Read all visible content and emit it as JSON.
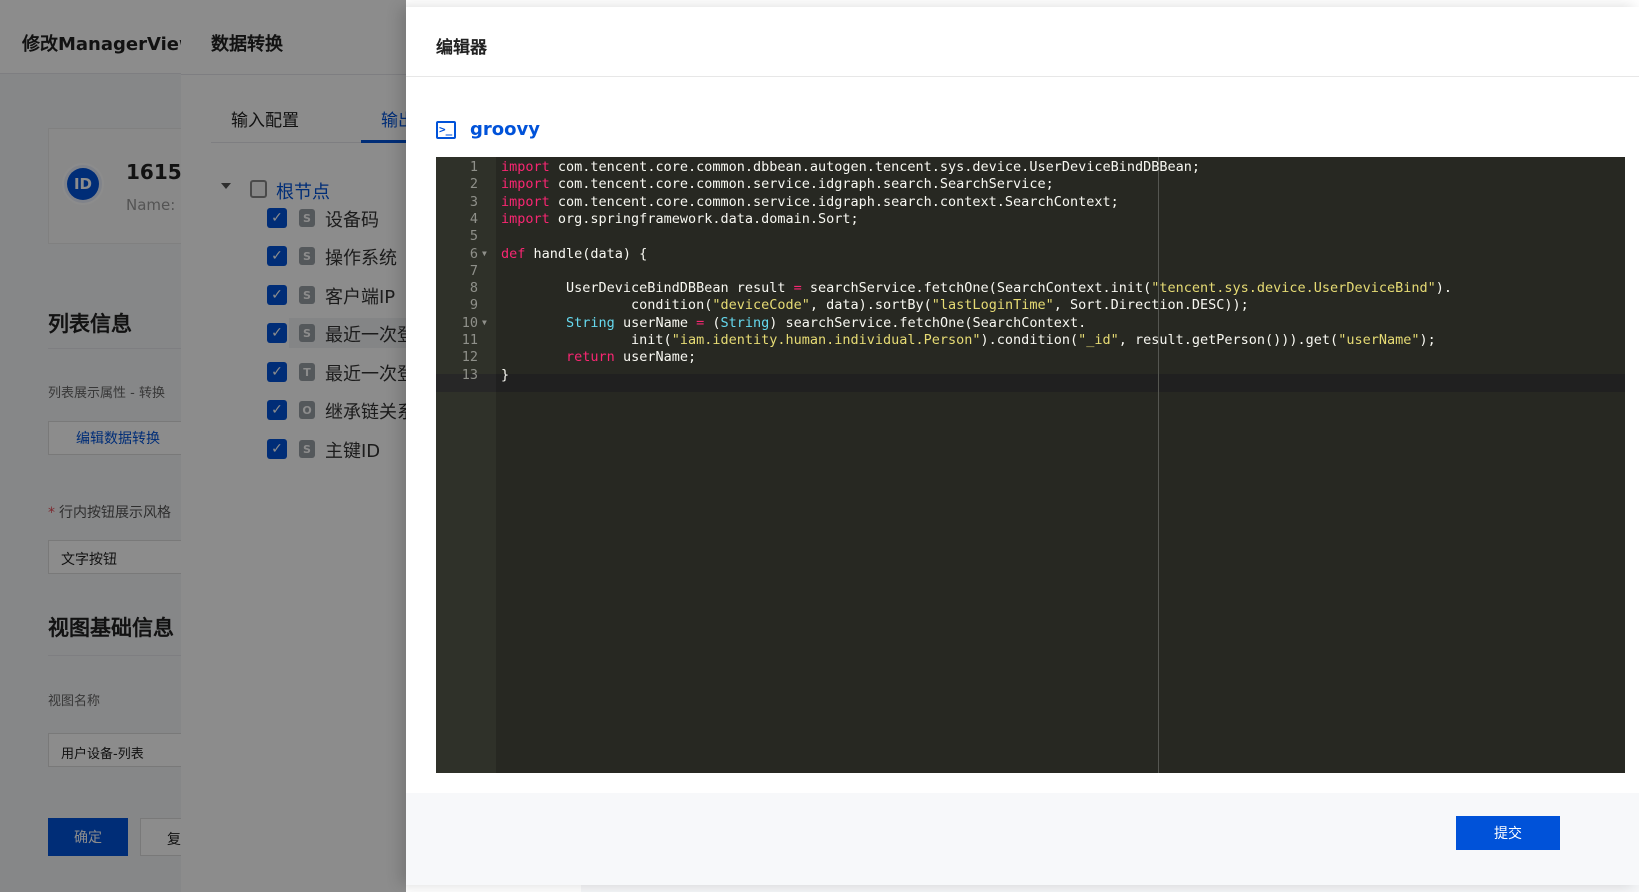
{
  "base_page": {
    "title": "修改ManagerView",
    "id_badge": "ID",
    "id_number": "1615",
    "id_name_prefix": "Name:",
    "section_list_info": "列表信息",
    "list_subtitle": "列表展示属性 - 转换",
    "edit_transform_button": "编辑数据转换",
    "inline_button_style_label": "行内按钮展示风格",
    "inline_button_style_value": "文字按钮",
    "section_view_basic": "视图基础信息",
    "view_name_label": "视图名称",
    "view_name_value": "用户设备-列表",
    "confirm_button": "确定",
    "reset_button": "复"
  },
  "transform_drawer": {
    "title": "数据转换",
    "tabs": [
      {
        "label": "输入配置"
      },
      {
        "label": "输出"
      }
    ],
    "root_node": "根节点",
    "nodes": [
      {
        "label": "设备码",
        "type": "S"
      },
      {
        "label": "操作系统",
        "type": "S"
      },
      {
        "label": "客户端IP",
        "type": "S"
      },
      {
        "label": "最近一次登",
        "type": "S"
      },
      {
        "label": "最近一次登",
        "type": "T"
      },
      {
        "label": "继承链关系",
        "type": "O"
      },
      {
        "label": "主键ID",
        "type": "S"
      }
    ]
  },
  "editor_drawer": {
    "title": "编辑器",
    "language_icon": ">_",
    "language": "groovy",
    "submit_button": "提交",
    "line_numbers": [
      "1",
      "2",
      "3",
      "4",
      "5",
      "6",
      "7",
      "8",
      "9",
      "10",
      "11",
      "12",
      "13"
    ],
    "code_lines": [
      "import com.tencent.core.common.dbbean.autogen.tencent.sys.device.UserDeviceBindDBBean;",
      "import com.tencent.core.common.service.idgraph.search.SearchService;",
      "import com.tencent.core.common.service.idgraph.search.context.SearchContext;",
      "import org.springframework.data.domain.Sort;",
      "",
      "def handle(data) {",
      "",
      "        UserDeviceBindDBBean result = searchService.fetchOne(SearchContext.init(\"tencent.sys.device.UserDeviceBind\").",
      "                condition(\"deviceCode\", data).sortBy(\"lastLoginTime\", Sort.Direction.DESC));",
      "        String userName = (String) searchService.fetchOne(SearchContext.",
      "                init(\"iam.identity.human.individual.Person\").condition(\"_id\", result.getPerson())).get(\"userName\");",
      "        return userName;",
      "}"
    ]
  },
  "colors": {
    "brand": "#0052d9",
    "editor_bg": "#272822",
    "keyword": "#f92672",
    "type": "#66d9ef",
    "string": "#e6db74"
  }
}
